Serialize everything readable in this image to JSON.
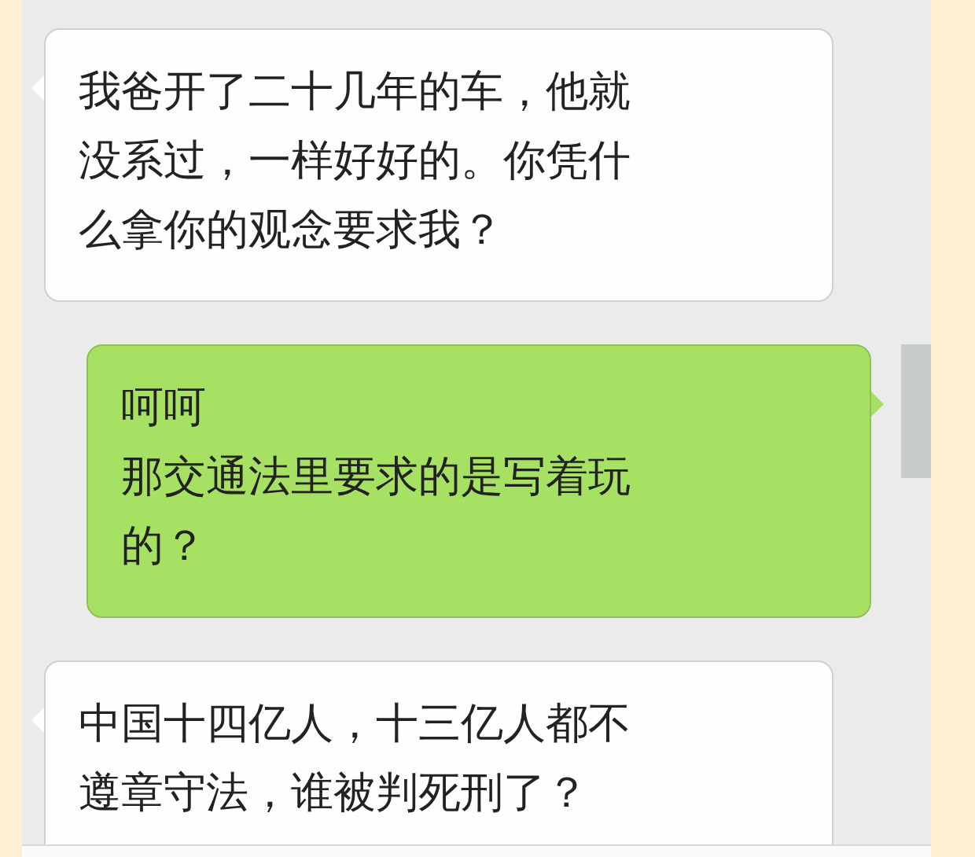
{
  "messages": [
    {
      "kind": "received",
      "lines": [
        "我爸开了二十几年的车，他就没系过，一样好好的。你凭什么拿你的观念要求我？"
      ]
    },
    {
      "kind": "sent",
      "lines": [
        "呵呵",
        "那交通法里要求的是写着玩的？"
      ]
    },
    {
      "kind": "received",
      "lines": [
        "中国十四亿人，十三亿人都不遵章守法，谁被判死刑了？"
      ]
    }
  ]
}
